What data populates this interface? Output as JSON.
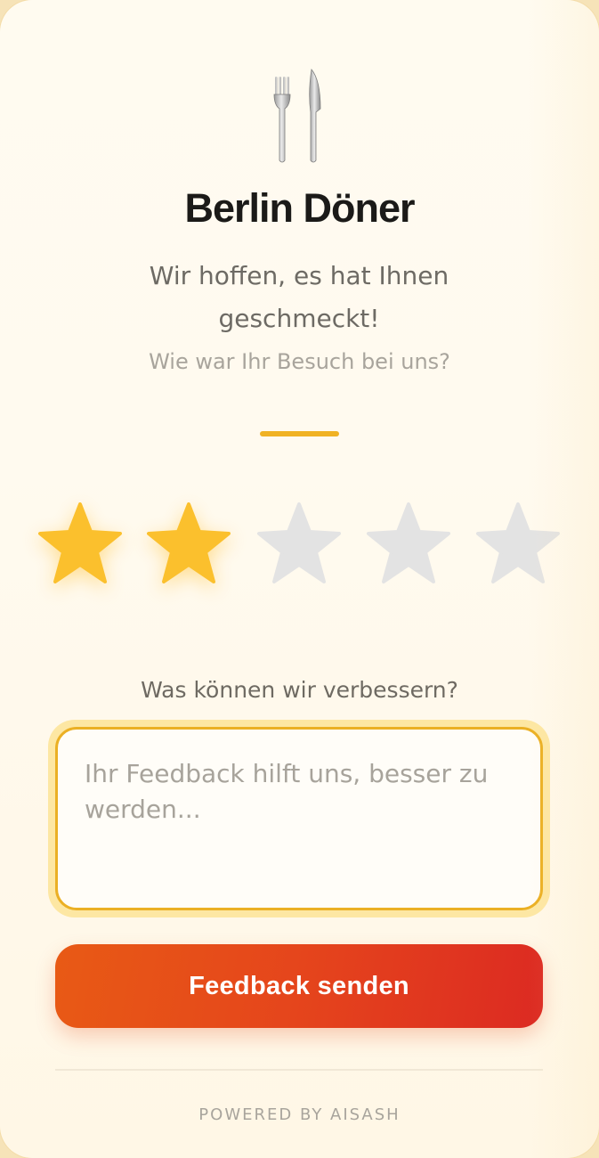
{
  "header": {
    "icon": "fork-and-knife-icon",
    "restaurant_name": "Berlin Döner",
    "subtitle": "Wir hoffen, es hat Ihnen geschmeckt!",
    "question": "Wie war Ihr Besuch bei uns?"
  },
  "rating": {
    "value": 2,
    "max": 5,
    "filled_color": "#FBC02D",
    "empty_color": "#E3E3E3"
  },
  "feedback": {
    "label": "Was können wir verbessern?",
    "placeholder": "Ihr Feedback hilft uns, besser zu werden...",
    "value": ""
  },
  "actions": {
    "send_label": "Feedback senden"
  },
  "footer": {
    "powered_by": "POWERED BY AISASH"
  },
  "colors": {
    "accent": "#F0B224",
    "button_start": "#E85A15",
    "button_end": "#DC2A22",
    "background": "#FFFBF0"
  }
}
